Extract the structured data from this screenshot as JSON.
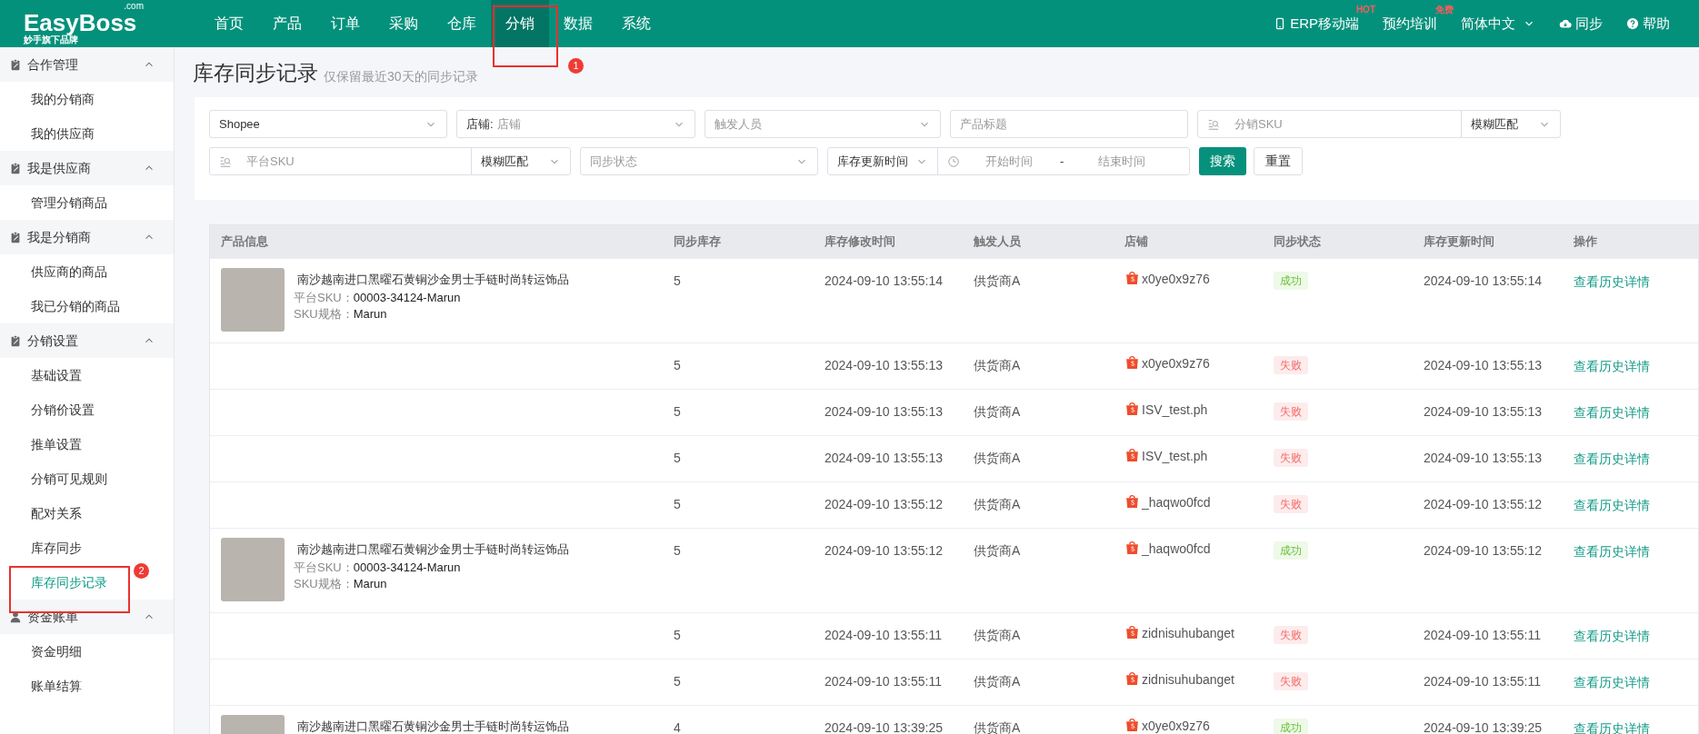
{
  "logo": {
    "name": "EasyBoss",
    "domain": ".com",
    "tagline": "妙手旗下品牌"
  },
  "nav": [
    {
      "label": "首页",
      "selected": false
    },
    {
      "label": "产品",
      "selected": false
    },
    {
      "label": "订单",
      "selected": false
    },
    {
      "label": "采购",
      "selected": false
    },
    {
      "label": "仓库",
      "selected": false
    },
    {
      "label": "分销",
      "selected": true
    },
    {
      "label": "数据",
      "selected": false
    },
    {
      "label": "系统",
      "selected": false
    }
  ],
  "top_actions": [
    {
      "kind": "mobile",
      "label": "ERP移动端",
      "badge": "HOT"
    },
    {
      "kind": "plain",
      "label": "预约培训",
      "badge": "免费"
    },
    {
      "kind": "dropdown",
      "label": "简体中文"
    },
    {
      "kind": "cloud",
      "label": "同步"
    },
    {
      "kind": "help",
      "label": "帮助"
    }
  ],
  "sidebar": [
    {
      "label": "合作管理",
      "kind": "clipboard",
      "expanded": true,
      "children": [
        {
          "label": "我的分销商",
          "selected": false
        },
        {
          "label": "我的供应商",
          "selected": false
        }
      ]
    },
    {
      "label": "我是供应商",
      "kind": "clipboard",
      "expanded": true,
      "children": [
        {
          "label": "管理分销商品",
          "selected": false
        }
      ]
    },
    {
      "label": "我是分销商",
      "kind": "clipboard",
      "expanded": true,
      "children": [
        {
          "label": "供应商的商品",
          "selected": false
        },
        {
          "label": "我已分销的商品",
          "selected": false
        }
      ]
    },
    {
      "label": "分销设置",
      "kind": "clipboard",
      "expanded": true,
      "children": [
        {
          "label": "基础设置",
          "selected": false
        },
        {
          "label": "分销价设置",
          "selected": false
        },
        {
          "label": "推单设置",
          "selected": false
        },
        {
          "label": "分销可见规则",
          "selected": false
        },
        {
          "label": "配对关系",
          "selected": false
        },
        {
          "label": "库存同步",
          "selected": false
        },
        {
          "label": "库存同步记录",
          "selected": true
        }
      ]
    },
    {
      "label": "资金账单",
      "kind": "person",
      "expanded": true,
      "children": [
        {
          "label": "资金明细",
          "selected": false
        },
        {
          "label": "账单结算",
          "selected": false
        }
      ]
    }
  ],
  "page": {
    "title": "库存同步记录",
    "subtitle": "仅保留最近30天的同步记录"
  },
  "filters": {
    "platform": {
      "value": "Shopee"
    },
    "shop": {
      "label": "店铺:",
      "placeholder": "店铺"
    },
    "trigger_user": {
      "placeholder": "触发人员"
    },
    "product_title": {
      "placeholder": "产品标题"
    },
    "distribution_sku": {
      "placeholder": "分销SKU",
      "match": "模糊匹配"
    },
    "platform_sku": {
      "placeholder": "平台SKU",
      "match": "模糊匹配"
    },
    "sync_status": {
      "placeholder": "同步状态"
    },
    "time_field": {
      "value": "库存更新时间"
    },
    "date_range": {
      "start_placeholder": "开始时间",
      "separator": "-",
      "end_placeholder": "结束时间"
    },
    "search_button": "搜索",
    "reset_button": "重置"
  },
  "table": {
    "columns": [
      "产品信息",
      "同步库存",
      "库存修改时间",
      "触发人员",
      "店铺",
      "同步状态",
      "库存更新时间",
      "操作"
    ],
    "rows": [
      {
        "product": {
          "title": "南沙越南进口黑曜石黄铜沙金男士手链时尚转运饰品",
          "sku_label": "平台SKU：",
          "sku": "00003-34124-Marun",
          "spec_label": "SKU规格：",
          "spec": "Marun"
        },
        "stock": "5",
        "modified": "2024-09-10 13:55:14",
        "user": "供货商A",
        "shop": "x0ye0x9z76",
        "status": {
          "kind": "success",
          "text": "成功"
        },
        "updated": "2024-09-10 13:55:14",
        "action": "查看历史详情"
      },
      {
        "stock": "5",
        "modified": "2024-09-10 13:55:13",
        "user": "供货商A",
        "shop": "x0ye0x9z76",
        "status": {
          "kind": "fail",
          "text": "失败"
        },
        "updated": "2024-09-10 13:55:13",
        "action": "查看历史详情"
      },
      {
        "stock": "5",
        "modified": "2024-09-10 13:55:13",
        "user": "供货商A",
        "shop": "ISV_test.ph",
        "status": {
          "kind": "fail",
          "text": "失败"
        },
        "updated": "2024-09-10 13:55:13",
        "action": "查看历史详情"
      },
      {
        "stock": "5",
        "modified": "2024-09-10 13:55:13",
        "user": "供货商A",
        "shop": "ISV_test.ph",
        "status": {
          "kind": "fail",
          "text": "失败"
        },
        "updated": "2024-09-10 13:55:13",
        "action": "查看历史详情"
      },
      {
        "stock": "5",
        "modified": "2024-09-10 13:55:12",
        "user": "供货商A",
        "shop": "_haqwo0fcd",
        "status": {
          "kind": "fail",
          "text": "失败"
        },
        "updated": "2024-09-10 13:55:12",
        "action": "查看历史详情"
      },
      {
        "product": {
          "title": "南沙越南进口黑曜石黄铜沙金男士手链时尚转运饰品",
          "sku_label": "平台SKU：",
          "sku": "00003-34124-Marun",
          "spec_label": "SKU规格：",
          "spec": "Marun"
        },
        "stock": "5",
        "modified": "2024-09-10 13:55:12",
        "user": "供货商A",
        "shop": "_haqwo0fcd",
        "status": {
          "kind": "success",
          "text": "成功"
        },
        "updated": "2024-09-10 13:55:12",
        "action": "查看历史详情"
      },
      {
        "stock": "5",
        "modified": "2024-09-10 13:55:11",
        "user": "供货商A",
        "shop": "zidnisuhubanget",
        "status": {
          "kind": "fail",
          "text": "失败"
        },
        "updated": "2024-09-10 13:55:11",
        "action": "查看历史详情"
      },
      {
        "stock": "5",
        "modified": "2024-09-10 13:55:11",
        "user": "供货商A",
        "shop": "zidnisuhubanget",
        "status": {
          "kind": "fail",
          "text": "失败"
        },
        "updated": "2024-09-10 13:55:11",
        "action": "查看历史详情"
      },
      {
        "product": {
          "title": "南沙越南进口黑曜石黄铜沙金男士手链时尚转运饰品"
        },
        "stock": "4",
        "modified": "2024-09-10 13:39:25",
        "user": "供货商A",
        "shop": "x0ye0x9z76",
        "status": {
          "kind": "success",
          "text": "成功"
        },
        "updated": "2024-09-10 13:39:25",
        "action": "查看历史详情"
      }
    ]
  },
  "annotations": [
    {
      "number": "1"
    },
    {
      "number": "2"
    }
  ]
}
